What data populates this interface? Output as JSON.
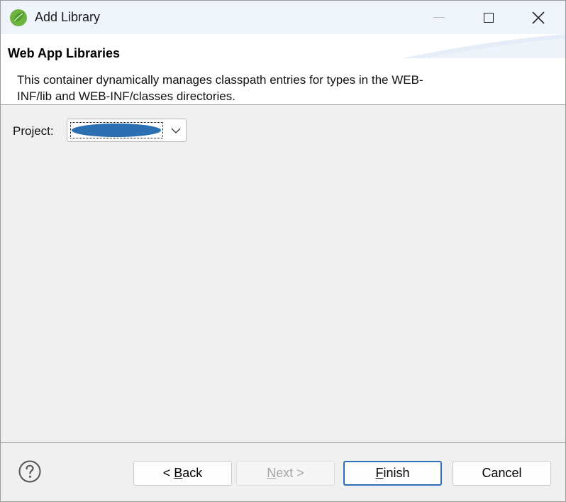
{
  "window": {
    "title": "Add Library",
    "icon": "spring-leaf-icon",
    "controls": [
      "minimize-icon",
      "maximize-icon",
      "close-icon"
    ]
  },
  "banner": {
    "title": "Web App Libraries",
    "description": "This container dynamically manages classpath entries for types in the WEB-INF/lib and WEB-INF/classes directories."
  },
  "form": {
    "project_label": "Project:",
    "project_value": "",
    "project_value_redacted": true
  },
  "footer": {
    "help_icon": "question-circle-icon",
    "back": {
      "prefix": "< ",
      "mnemonic": "B",
      "rest": "ack"
    },
    "next": {
      "mnemonic": "N",
      "rest": "ext >",
      "enabled": false
    },
    "finish": {
      "mnemonic": "F",
      "rest": "inish",
      "default": true
    },
    "cancel": {
      "label": "Cancel"
    }
  },
  "colors": {
    "accent": "#2f6fba",
    "redaction": "#2c6fb2",
    "spring_green": "#6db33f"
  }
}
